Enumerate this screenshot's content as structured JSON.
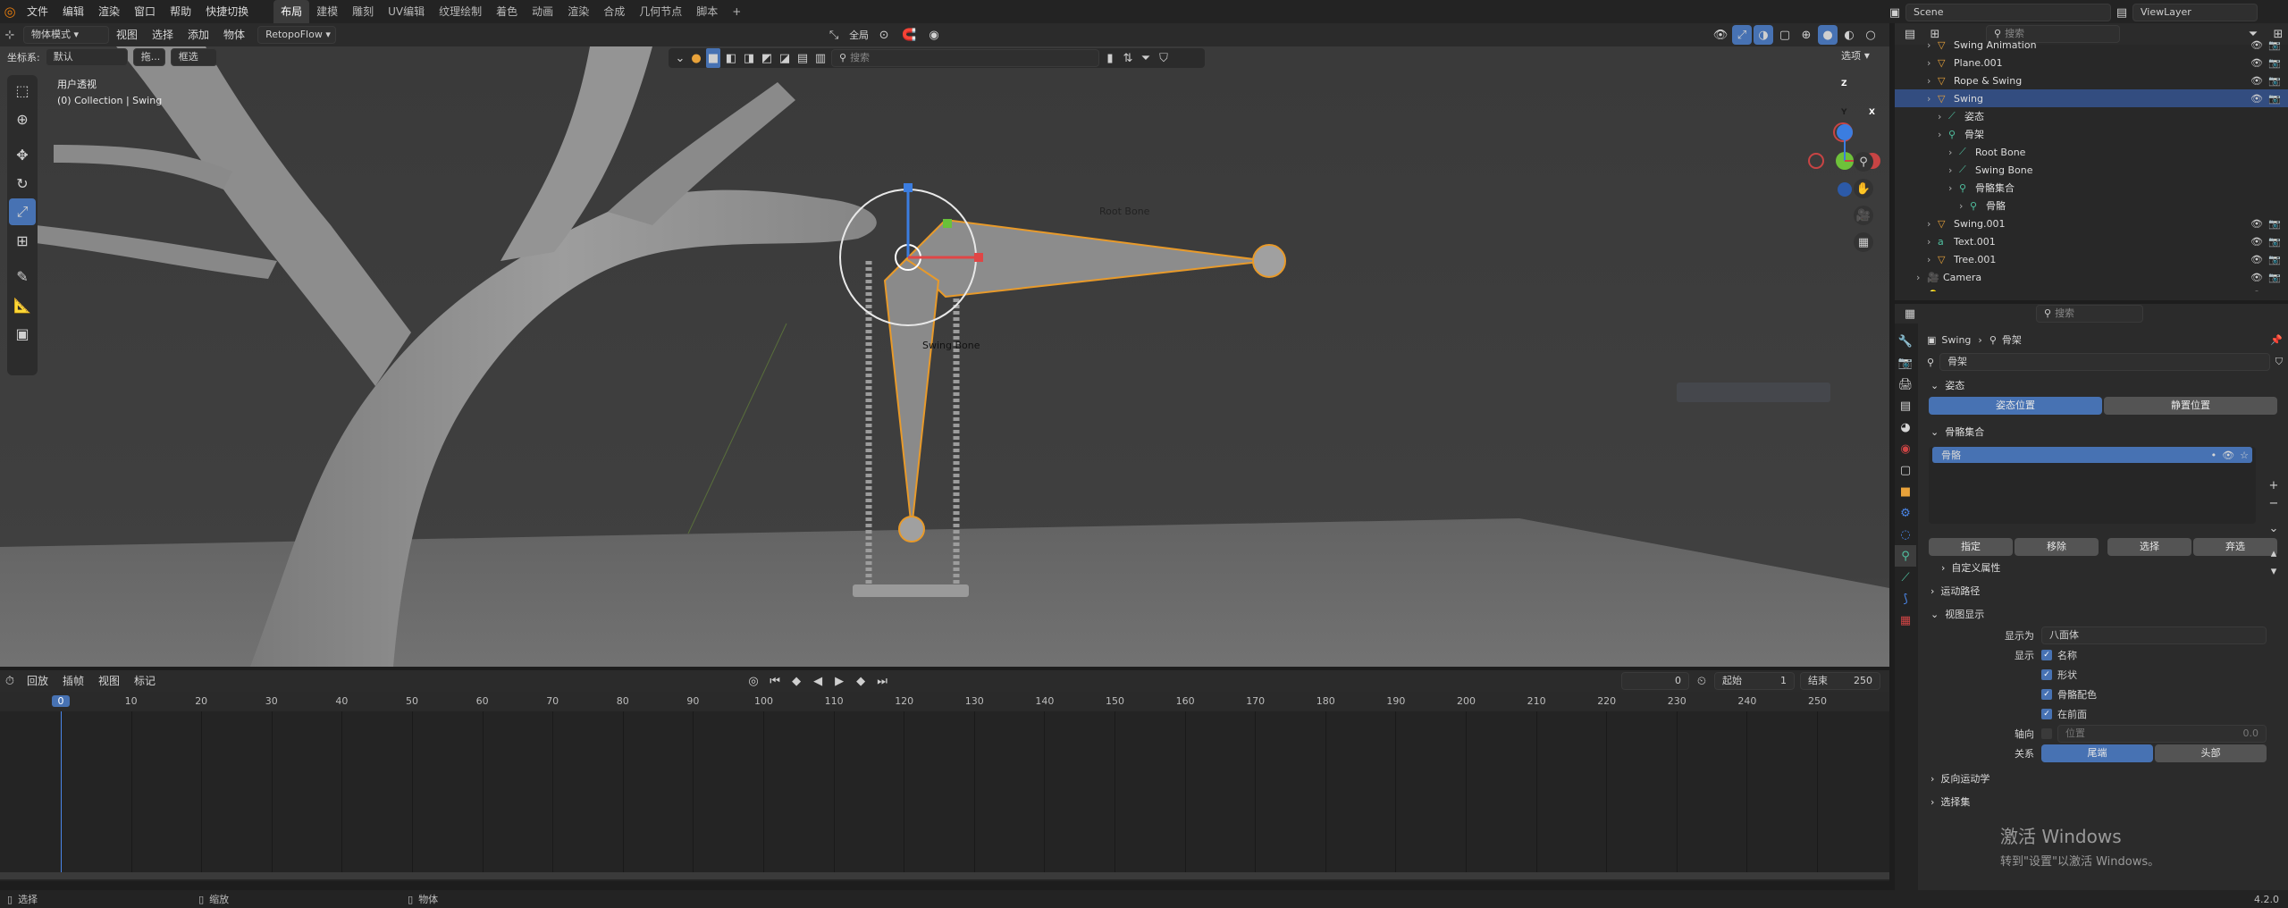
{
  "menu": [
    "文件",
    "编辑",
    "渲染",
    "窗口",
    "帮助",
    "快捷切换"
  ],
  "workspaces": [
    {
      "label": "布局",
      "active": true
    },
    {
      "label": "建模"
    },
    {
      "label": "雕刻"
    },
    {
      "label": "UV编辑"
    },
    {
      "label": "纹理绘制"
    },
    {
      "label": "着色"
    },
    {
      "label": "动画"
    },
    {
      "label": "渲染"
    },
    {
      "label": "合成"
    },
    {
      "label": "几何节点"
    },
    {
      "label": "脚本"
    },
    {
      "label": "+"
    }
  ],
  "scene": {
    "name": "Scene",
    "view_layer": "ViewLayer"
  },
  "viewport_header": {
    "mode": "物体模式",
    "menus": [
      "视图",
      "选择",
      "添加",
      "物体"
    ],
    "addon": "RetopoFlow",
    "global": "全局",
    "options": "选项",
    "search_placeholder": "搜索"
  },
  "tool_header": {
    "coord_label": "坐标系:",
    "coord_value": "默认",
    "drag_label": "拖...",
    "select_mode": "框选"
  },
  "viewport": {
    "view_name": "用户透视",
    "collection": "(0) Collection | Swing",
    "bone_labels": [
      "Root Bone",
      "Swing Bone"
    ]
  },
  "timeline": {
    "menus": [
      "回放",
      "插帧",
      "视图",
      "标记"
    ],
    "current_frame": "0",
    "start_label": "起始",
    "start": "1",
    "end_label": "结束",
    "end": "250",
    "ticks": [
      "0",
      "10",
      "20",
      "30",
      "40",
      "50",
      "60",
      "70",
      "80",
      "90",
      "100",
      "110",
      "120",
      "130",
      "140",
      "150",
      "160",
      "170",
      "180",
      "190",
      "200",
      "210",
      "220",
      "230",
      "240",
      "250"
    ]
  },
  "status": {
    "left": "选择",
    "mid": "缩放",
    "right": "物体",
    "version": "4.2.0"
  },
  "outliner": {
    "search_placeholder": "搜索",
    "items": [
      {
        "label": "Swing Animation",
        "indent": 3
      },
      {
        "label": "Plane.001",
        "indent": 3
      },
      {
        "label": "Rope & Swing",
        "indent": 3
      },
      {
        "label": "Swing",
        "indent": 3,
        "selected": true
      },
      {
        "label": "姿态",
        "indent": 4
      },
      {
        "label": "骨架",
        "indent": 4
      },
      {
        "label": "Root Bone",
        "indent": 5
      },
      {
        "label": "Swing Bone",
        "indent": 5
      },
      {
        "label": "骨骼集合",
        "indent": 5
      },
      {
        "label": "骨骼",
        "indent": 6
      },
      {
        "label": "Swing.001",
        "indent": 3
      },
      {
        "label": "Text.001",
        "indent": 3
      },
      {
        "label": "Tree.001",
        "indent": 3
      },
      {
        "label": "Camera",
        "indent": 2
      },
      {
        "label": "Light",
        "indent": 2
      }
    ]
  },
  "properties": {
    "search_placeholder": "搜索",
    "breadcrumb_object": "Swing",
    "breadcrumb_data": "骨架",
    "data_name": "骨架",
    "pose_section": "姿态",
    "pose_position": "姿态位置",
    "rest_position": "静置位置",
    "bone_collections": "骨骼集合",
    "collection_item": "骨骼",
    "assign": "指定",
    "remove": "移除",
    "select": "选择",
    "deselect": "弃选",
    "custom_props": "自定义属性",
    "motion_paths": "运动路径",
    "viewport_display": "视图显示",
    "display_as_label": "显示为",
    "display_as_value": "八面体",
    "show_label": "显示",
    "show_names": "名称",
    "show_shapes": "形状",
    "show_colors": "骨骼配色",
    "show_in_front": "在前面",
    "axes_label": "轴向",
    "axes_position_label": "位置",
    "axes_position_value": "0.0",
    "relations_label": "关系",
    "relation_tail": "尾端",
    "relation_head": "头部",
    "ik_section": "反向运动学",
    "selection_sets": "选择集",
    "watermark_title": "激活 Windows",
    "watermark_sub": "转到\"设置\"以激活 Windows。"
  }
}
